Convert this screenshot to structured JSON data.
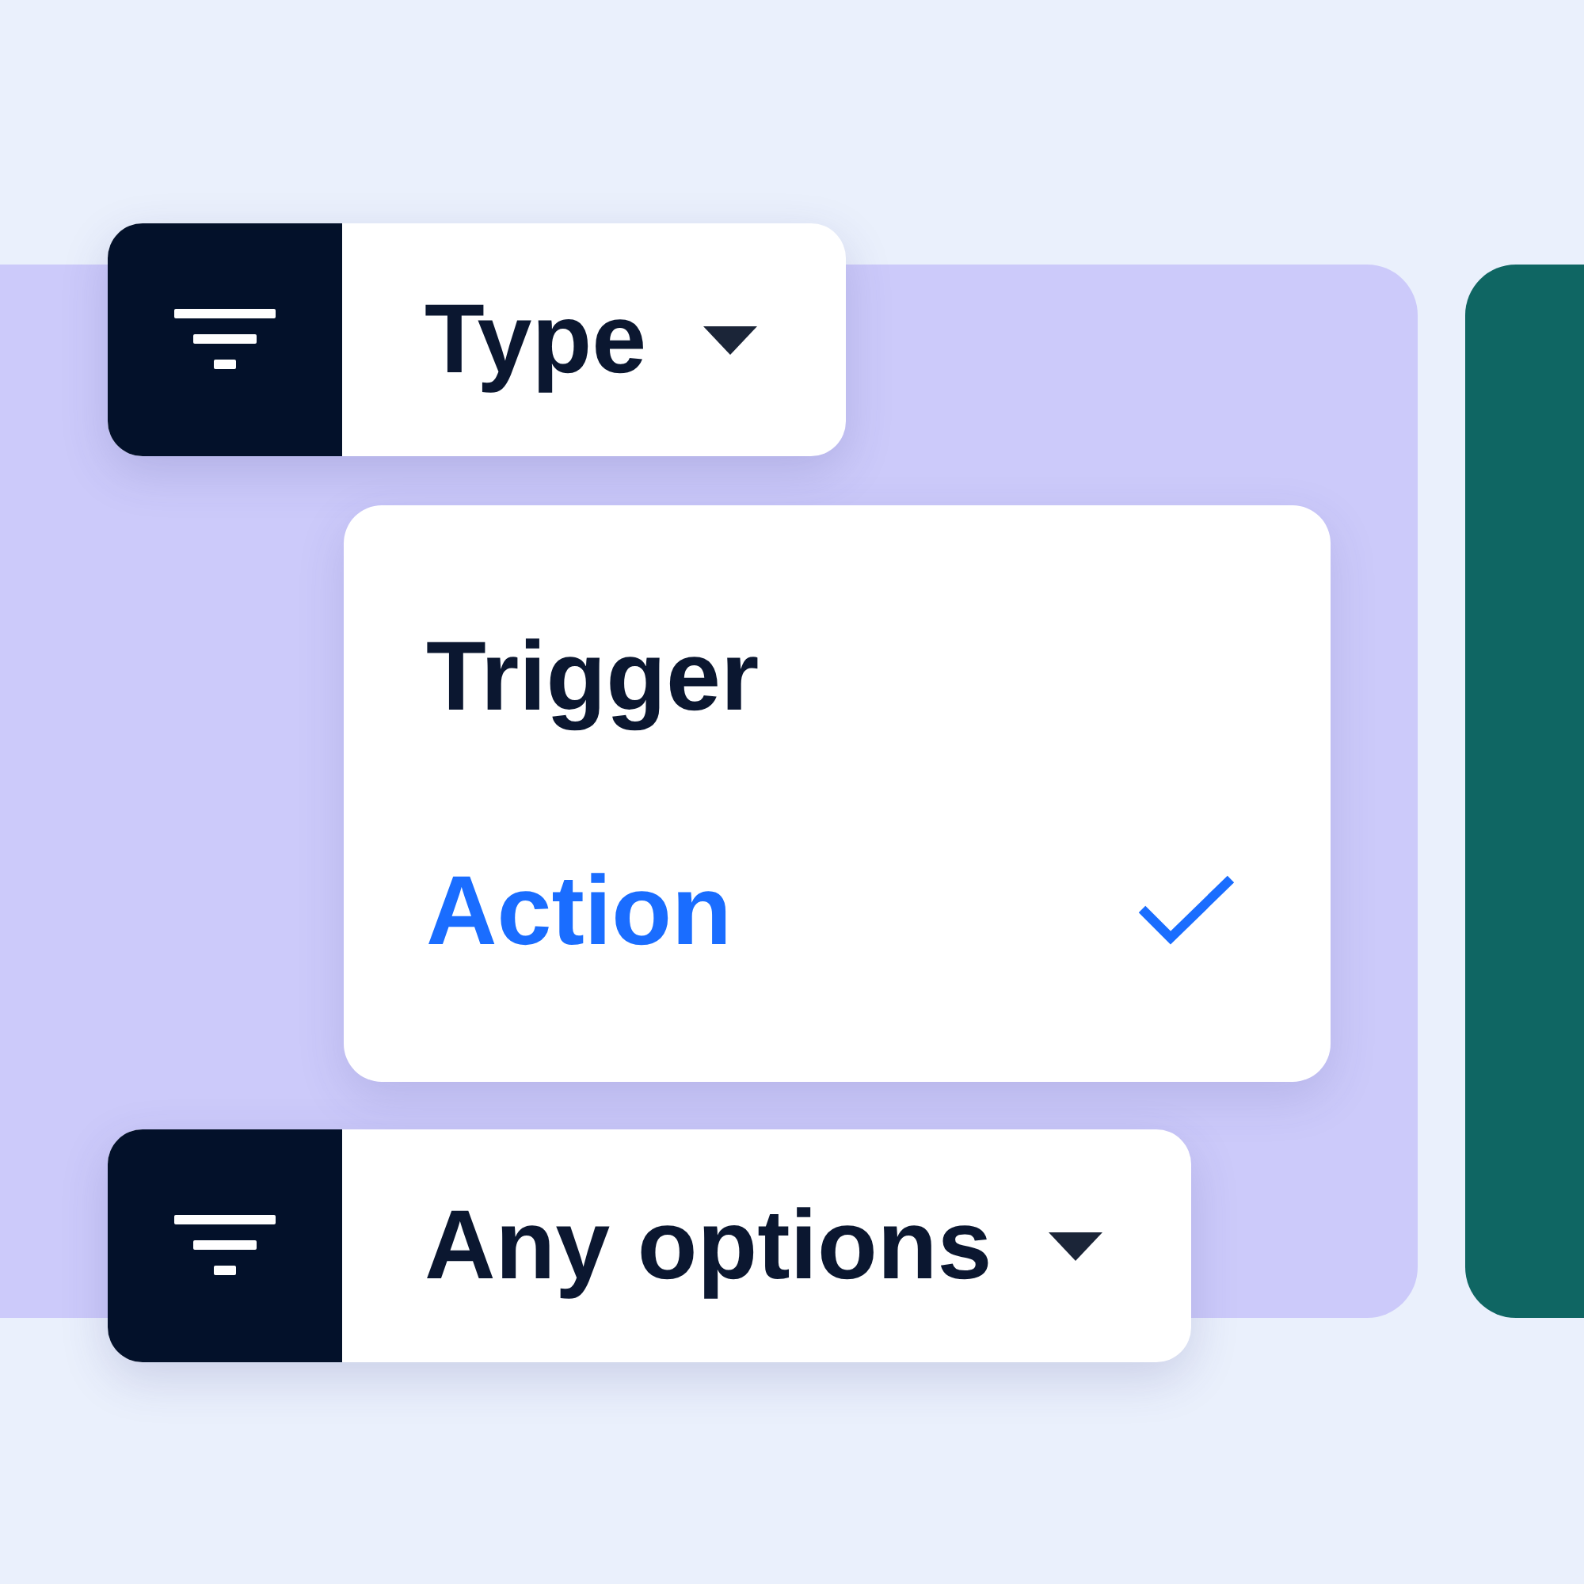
{
  "filters": [
    {
      "label": "Type"
    },
    {
      "label": "Any options"
    }
  ],
  "dropdown": {
    "options": [
      {
        "label": "Trigger",
        "selected": false
      },
      {
        "label": "Action",
        "selected": true
      }
    ]
  }
}
